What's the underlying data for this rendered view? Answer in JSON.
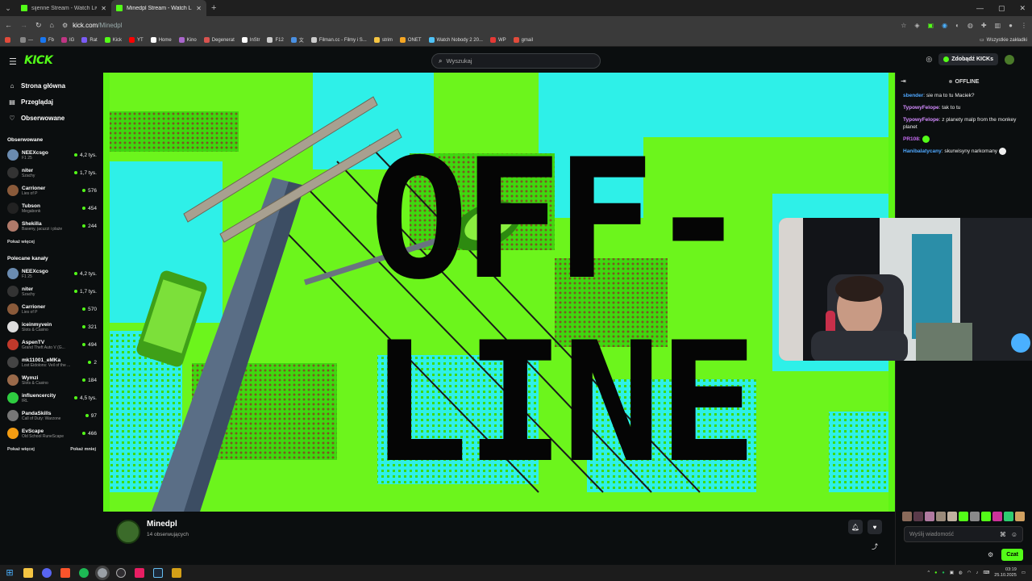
{
  "browser": {
    "tabs": [
      {
        "label": "sijenne Stream - Watch Live o",
        "active": false
      },
      {
        "label": "Minedpl Stream - Watch Live o",
        "active": true
      }
    ],
    "new_tab": "+",
    "url_host": "kick.com",
    "url_path": "/Minedpl",
    "bookmarks": [
      {
        "label": "",
        "color": "#e24b3b"
      },
      {
        "label": "—",
        "color": "#888888"
      },
      {
        "label": "Fb",
        "color": "#1877f2"
      },
      {
        "label": "IG",
        "color": "#c13584"
      },
      {
        "label": "Rat",
        "color": "#7b5cf5"
      },
      {
        "label": "Kick",
        "color": "#53fc18"
      },
      {
        "label": "YT",
        "color": "#ff0000"
      },
      {
        "label": "Home",
        "color": "#ffffff"
      },
      {
        "label": "Kino",
        "color": "#aa66cc"
      },
      {
        "label": "Degenerat",
        "color": "#d9534f"
      },
      {
        "label": "InStr",
        "color": "#ffffff"
      },
      {
        "label": "F12",
        "color": "#cccccc"
      },
      {
        "label": "文",
        "color": "#4a90e2"
      },
      {
        "label": "Filman.cc - Filmy i S...",
        "color": "#cccccc"
      },
      {
        "label": "strim",
        "color": "#f5c542"
      },
      {
        "label": "ONET",
        "color": "#f5a623"
      },
      {
        "label": "Watch Nobody 2 20...",
        "color": "#4fc3f7"
      },
      {
        "label": "WP",
        "color": "#e53935"
      },
      {
        "label": "gmail",
        "color": "#e24b3b"
      }
    ],
    "bookmarks_right": "Wszystkie zakładki"
  },
  "kick": {
    "logo": "KICK",
    "search_placeholder": "Wyszukaj",
    "get_kicks": "Zdobądź KICKs"
  },
  "sidebar": {
    "nav": [
      {
        "label": "Strona główna",
        "icon": "home-icon",
        "glyph": "⌂"
      },
      {
        "label": "Przeglądaj",
        "icon": "browse-icon",
        "glyph": "▤"
      },
      {
        "label": "Obserwowane",
        "icon": "heart-icon",
        "glyph": "♡"
      }
    ],
    "followed_title": "Obserwowane",
    "followed": [
      {
        "name": "NEEXcsgo",
        "category": "F1 25",
        "viewers": "4,2 tys.",
        "color": "#6a8bb0"
      },
      {
        "name": "niter",
        "category": "Szachy",
        "viewers": "1,7 tys.",
        "color": "#333333"
      },
      {
        "name": "Carrioner",
        "category": "Lies of P",
        "viewers": "576",
        "color": "#8a5a3a"
      },
      {
        "name": "Tubson",
        "category": "Megabonk",
        "viewers": "454",
        "color": "#222222"
      },
      {
        "name": "Shekilla",
        "category": "Baseny, jacuzzi i plaże",
        "viewers": "244",
        "color": "#b07a6a"
      }
    ],
    "show_more": "Pokaż więcej",
    "recommended_title": "Polecane kanały",
    "recommended": [
      {
        "name": "NEEXcsgo",
        "category": "F1 25",
        "viewers": "4,2 tys.",
        "color": "#6a8bb0"
      },
      {
        "name": "niter",
        "category": "Szachy",
        "viewers": "1,7 tys.",
        "color": "#333333"
      },
      {
        "name": "Carrioner",
        "category": "Lies of P",
        "viewers": "570",
        "color": "#8a5a3a"
      },
      {
        "name": "iceinmyvein",
        "category": "Slots & Casino",
        "viewers": "321",
        "color": "#dddddd"
      },
      {
        "name": "AspenTV",
        "category": "Grand Theft Auto V (G...",
        "viewers": "494",
        "color": "#c0392b"
      },
      {
        "name": "mk11001_eMKa",
        "category": "Lost Eidolons: Veil of the ...",
        "viewers": "2",
        "color": "#444444"
      },
      {
        "name": "Wymzi",
        "category": "Slots & Casino",
        "viewers": "184",
        "color": "#9a6a4a"
      },
      {
        "name": "influencercity",
        "category": "IRL",
        "viewers": "4,5 tys.",
        "color": "#2ecc40"
      },
      {
        "name": "PandaSkills",
        "category": "Call of Duty: Warzone",
        "viewers": "97",
        "color": "#777777"
      },
      {
        "name": "EvScape",
        "category": "Old School RuneScape",
        "viewers": "466",
        "color": "#f39c12"
      }
    ],
    "show_more2": "Pokaż więcej",
    "show_less": "Pokaż mniej"
  },
  "player": {
    "offline_line1": "OFF-",
    "offline_line2": "LINE"
  },
  "stream": {
    "streamer": "Minedpl",
    "followers": "14 obserwujących"
  },
  "chat": {
    "status": "OFFLINE",
    "messages": [
      {
        "user": "sbender",
        "color": "#4fa8ff",
        "text": "sie ma to tu Maciek?"
      },
      {
        "user": "TypowyFelope",
        "color": "#d48cff",
        "text": "tak to tu"
      },
      {
        "user": "TypowyFelope",
        "color": "#d48cff",
        "text": "z planety malp from the monkey planet"
      },
      {
        "user": "PR108",
        "color": "#c56cf0",
        "text": ""
      },
      {
        "user": "Hanibalatycany",
        "color": "#4fa8ff",
        "text": "skurwisyny narkomany"
      }
    ],
    "input_placeholder": "Wyślij wiadomość",
    "send": "Czat"
  },
  "taskbar": {
    "time": "03:19",
    "date": "25.10.2025"
  }
}
